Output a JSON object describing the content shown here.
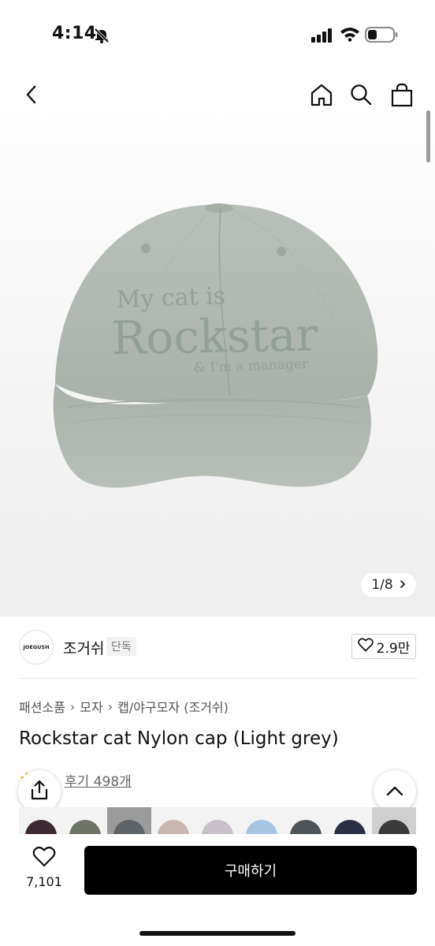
{
  "status_bar": {
    "time": "4:14"
  },
  "image_viewer": {
    "counter": "1/8",
    "alt": "Rockstar cap"
  },
  "cap_embroidery": {
    "line1": "My cat is",
    "line2": "Rockstar",
    "line3": "& I'm a manager"
  },
  "brand": {
    "logo_text": "JOEGUSH",
    "name": "조거쉬",
    "badge": "단독",
    "likes": "2.9만"
  },
  "breadcrumb": [
    "패션소품",
    "모자",
    "캡/야구모자 (조거쉬)"
  ],
  "product": {
    "title": "Rockstar cat Nylon cap (Light grey)",
    "reviews": "후기 498개"
  },
  "color_options": [
    "#3b2a31",
    "#6e7566",
    "#5e6368",
    "#c9b6b0",
    "#c7c0c8",
    "#a9c3e3",
    "#4f5459",
    "#2b2f44",
    "#3a3a3a"
  ],
  "bottom_bar": {
    "wish_count": "7,101",
    "buy_label": "구매하기"
  },
  "colors": {
    "accent": "#000000",
    "cap": "#b3bab3",
    "cap_embroidery": "#95a09a"
  }
}
